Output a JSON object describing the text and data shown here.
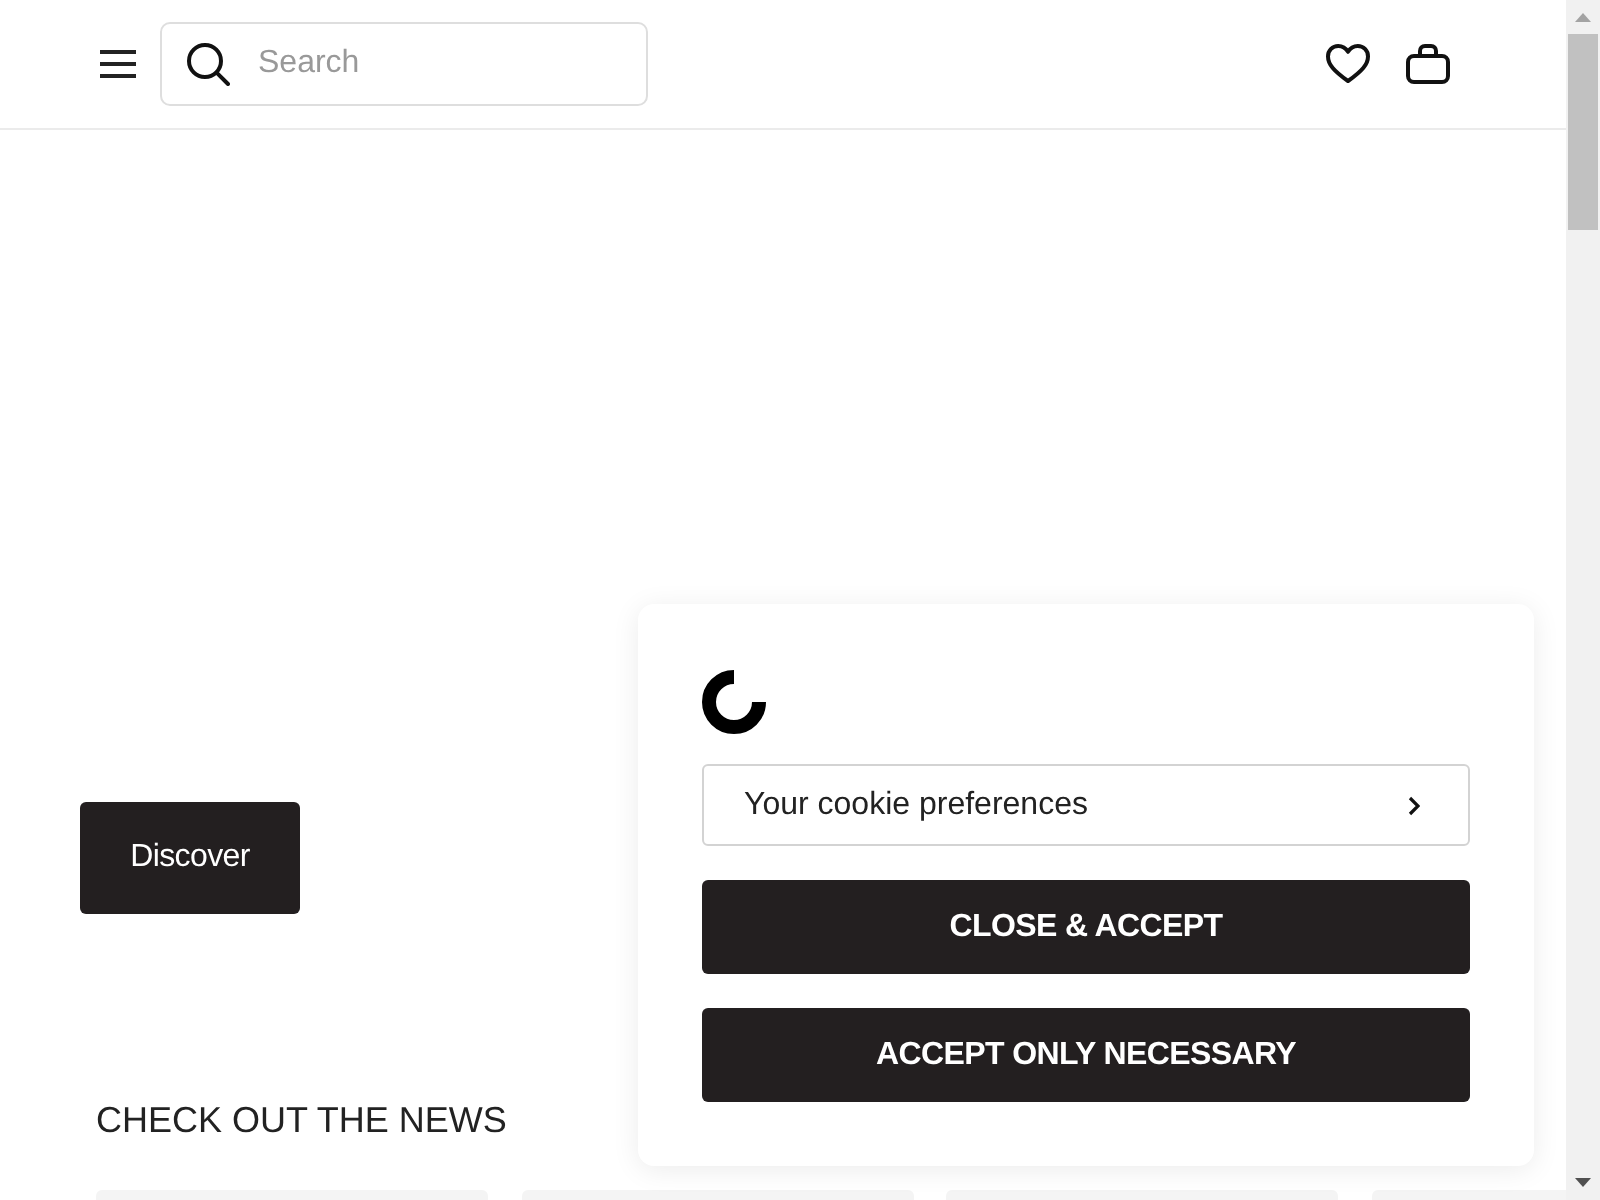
{
  "header": {
    "search": {
      "placeholder": "Search"
    }
  },
  "hero": {
    "button": "Discover"
  },
  "news": {
    "title": "CHECK OUT THE NEWS"
  },
  "cookie_dialog": {
    "preferences_button": "Your cookie preferences",
    "buttons": [
      "CLOSE & ACCEPT",
      "ACCEPT ONLY NECESSARY"
    ]
  }
}
